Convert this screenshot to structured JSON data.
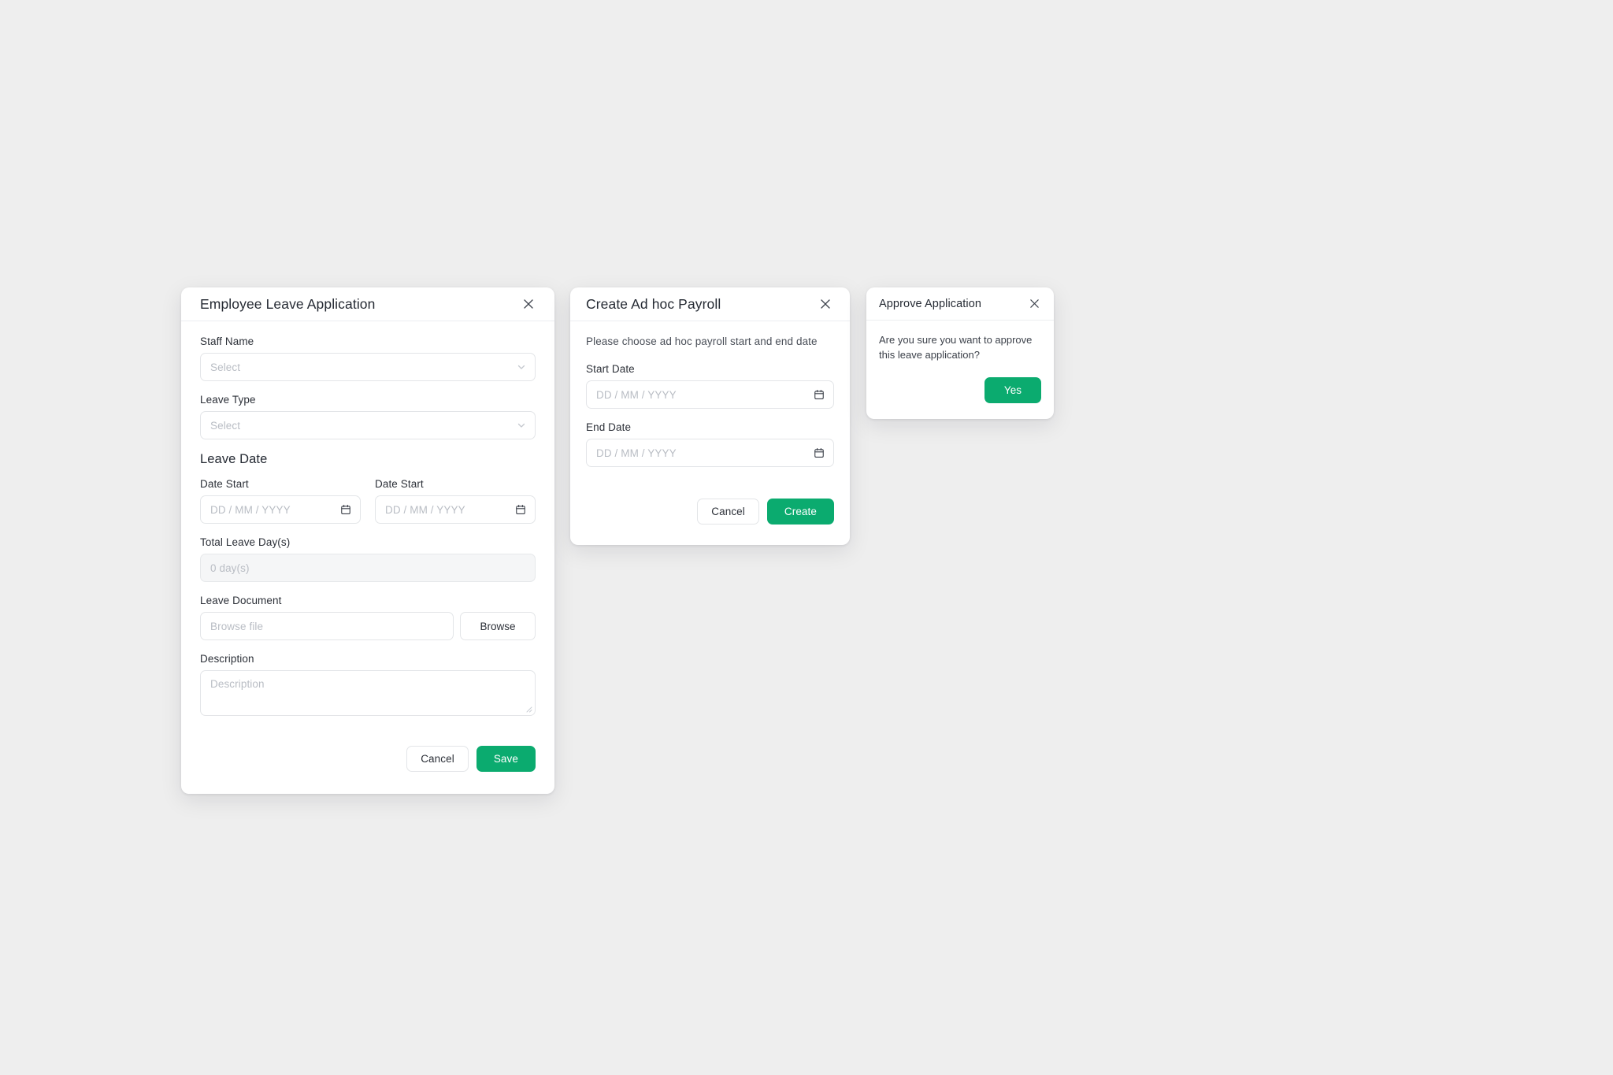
{
  "theme": {
    "page_background": "#eeeeee",
    "accent_green": "#0bab6f",
    "border": "#e3e5e8",
    "placeholder": "#b9bdc4",
    "label": "#2c3038"
  },
  "leave_modal": {
    "title": "Employee Leave Application",
    "close_icon": "close-icon",
    "staff_name": {
      "label": "Staff Name",
      "placeholder": "Select",
      "icon": "chevron-down-icon"
    },
    "leave_type": {
      "label": "Leave Type",
      "placeholder": "Select",
      "icon": "chevron-down-icon"
    },
    "leave_date_section": "Leave Date",
    "date_start": {
      "label": "Date Start",
      "placeholder": "DD / MM / YYYY",
      "icon": "calendar-icon"
    },
    "date_start_2": {
      "label": "Date Start",
      "placeholder": "DD / MM / YYYY",
      "icon": "calendar-icon"
    },
    "total_leave_days": {
      "label": "Total Leave Day(s)",
      "value": "0 day(s)"
    },
    "leave_document": {
      "label": "Leave Document",
      "placeholder": "Browse file",
      "browse_label": "Browse"
    },
    "description": {
      "label": "Description",
      "placeholder": "Description"
    },
    "cancel_label": "Cancel",
    "save_label": "Save"
  },
  "payroll_modal": {
    "title": "Create Ad hoc Payroll",
    "close_icon": "close-icon",
    "intro": "Please choose ad hoc payroll start and end date",
    "start_date": {
      "label": "Start Date",
      "placeholder": "DD / MM / YYYY",
      "icon": "calendar-icon"
    },
    "end_date": {
      "label": "End Date",
      "placeholder": "DD / MM / YYYY",
      "icon": "calendar-icon"
    },
    "cancel_label": "Cancel",
    "create_label": "Create"
  },
  "approve_modal": {
    "title": "Approve Application",
    "close_icon": "close-icon",
    "message": "Are you sure you want to approve this leave application?",
    "yes_label": "Yes"
  }
}
